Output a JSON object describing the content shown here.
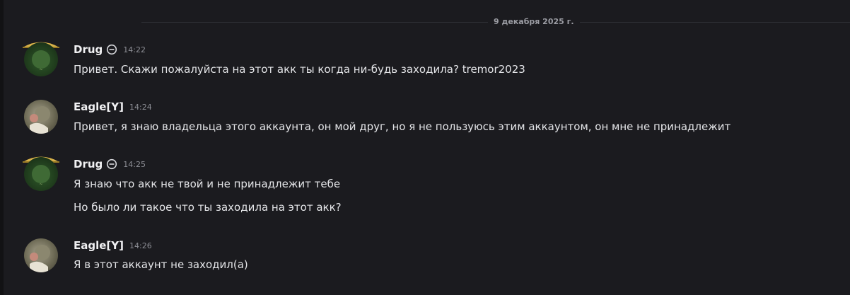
{
  "date_divider": "9 декабря 2025 г.",
  "messages": [
    {
      "author": "Drug",
      "time": "14:22",
      "lines": [
        "Привет. Скажи пожалуйста на этот акк ты когда ни-будь заходила? tremor2023"
      ]
    },
    {
      "author": "Eagle[Y]",
      "time": "14:24",
      "lines": [
        "Привет, я знаю владельца этого аккаунта, он мой друг, но я не пользуюсь этим аккаунтом, он мне не принадлежит"
      ]
    },
    {
      "author": "Drug",
      "time": "14:25",
      "lines": [
        "Я знаю что акк не твой и не принадлежит тебе",
        "Но было ли такое что ты заходила на этот акк?"
      ]
    },
    {
      "author": "Eagle[Y]",
      "time": "14:26",
      "lines": [
        "Я в этот аккаунт не заходил(а)"
      ]
    }
  ],
  "icons": {
    "status": "do-not-disturb-icon"
  }
}
